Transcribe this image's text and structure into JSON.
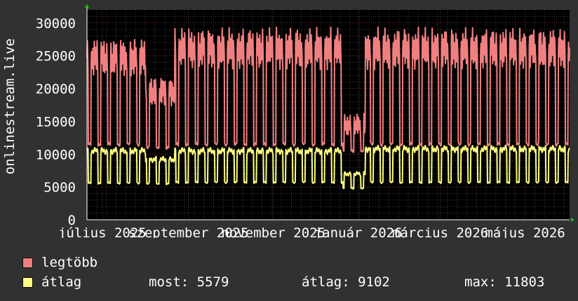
{
  "chart_data": {
    "type": "line",
    "ylabel": "onlinestream.live",
    "ylim": [
      0,
      32000
    ],
    "yticks": [
      0,
      5000,
      10000,
      15000,
      20000,
      25000,
      30000
    ],
    "xticks": [
      {
        "label": "július 2025",
        "x": "2025-07-01"
      },
      {
        "label": "szeptember 2025",
        "x": "2025-09-01"
      },
      {
        "label": "november 2025",
        "x": "2025-11-01"
      },
      {
        "label": "január 2026",
        "x": "2026-01-01"
      },
      {
        "label": "március 2026",
        "x": "2026-03-01"
      },
      {
        "label": "május 2026",
        "x": "2026-05-01"
      }
    ],
    "xlim": [
      "2025-06-20",
      "2026-06-02"
    ],
    "grid": true,
    "legend_placement": "bottom-left",
    "series": [
      {
        "name": "legtöbb",
        "color": "#f08080",
        "description_by_period": [
          {
            "x": [
              "2025-06-20",
              "2025-07-31"
            ],
            "weekday_peak": 26500,
            "weekend_low": 11500
          },
          {
            "x": [
              "2025-08-01",
              "2025-08-21"
            ],
            "weekday_peak": 21000,
            "weekend_low": 11000
          },
          {
            "x": [
              "2025-08-22",
              "2025-12-20"
            ],
            "weekday_peak": 28000,
            "weekend_low": 11500
          },
          {
            "x": [
              "2025-12-21",
              "2026-01-05"
            ],
            "weekday_peak": 15500,
            "weekend_low": 10500
          },
          {
            "x": [
              "2026-01-06",
              "2026-06-01"
            ],
            "weekday_peak": 28000,
            "weekend_low": 11500
          }
        ],
        "max_observed": 31000
      },
      {
        "name": "átlag",
        "color": "#ffff80",
        "description_by_period": [
          {
            "x": [
              "2025-06-20",
              "2025-07-31"
            ],
            "weekday_peak": 10500,
            "weekend_low": 5600
          },
          {
            "x": [
              "2025-08-01",
              "2025-08-21"
            ],
            "weekday_peak": 9200,
            "weekend_low": 5500
          },
          {
            "x": [
              "2025-08-22",
              "2025-12-20"
            ],
            "weekday_peak": 10500,
            "weekend_low": 5700
          },
          {
            "x": [
              "2025-12-21",
              "2026-01-05"
            ],
            "weekday_peak": 7000,
            "weekend_low": 4800
          },
          {
            "x": [
              "2026-01-06",
              "2026-06-01"
            ],
            "weekday_peak": 10800,
            "weekend_low": 5700
          }
        ]
      }
    ]
  },
  "legend": {
    "max_label": "legtöbb",
    "avg_label": "átlag",
    "most": "most: 5579",
    "atlag": "átlag: 9102",
    "max": "max: 11803"
  }
}
